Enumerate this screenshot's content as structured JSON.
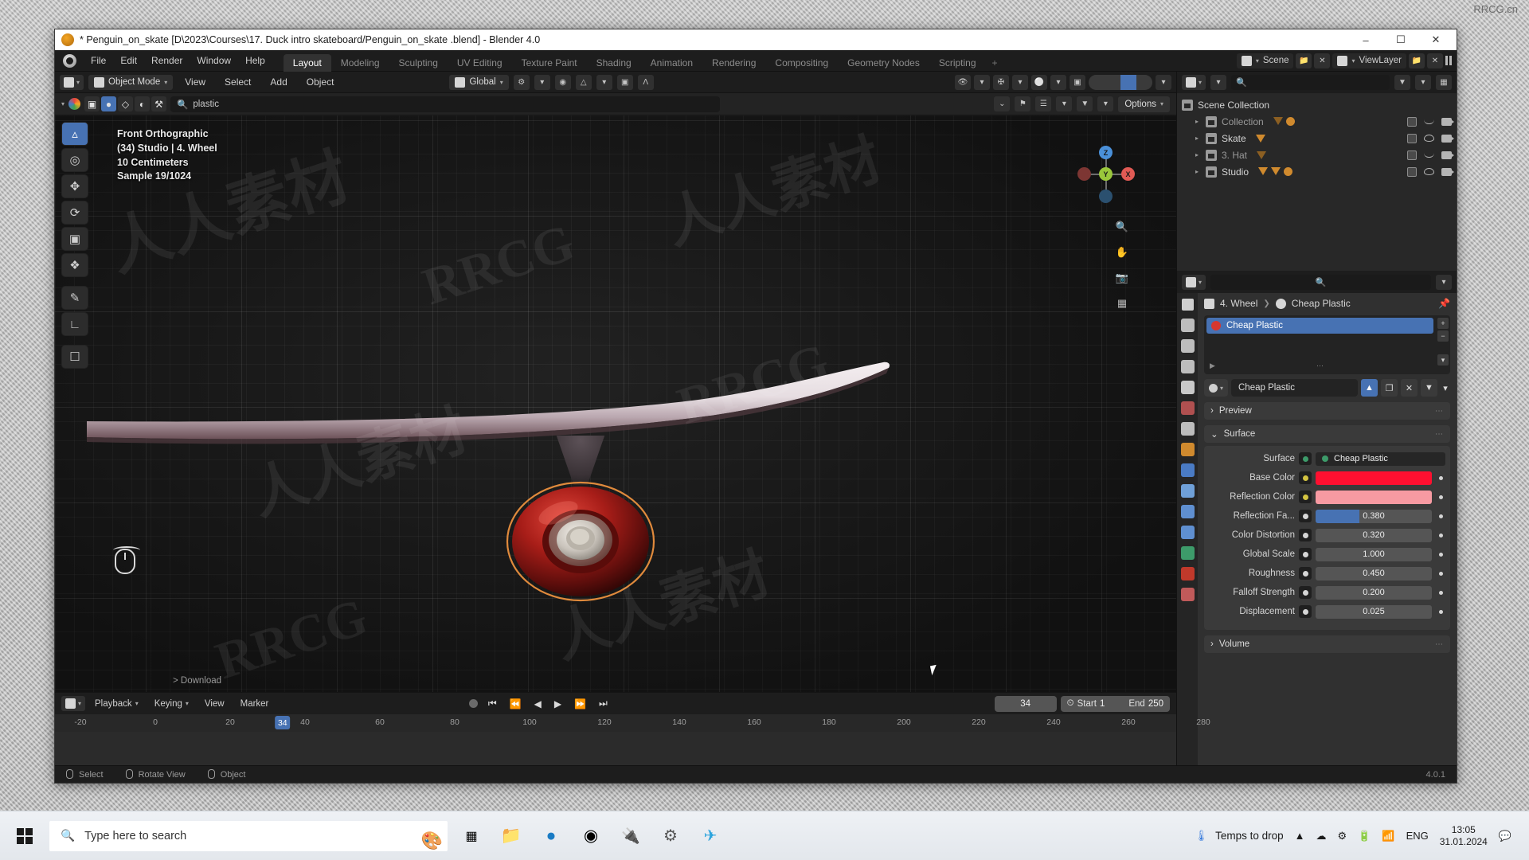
{
  "window": {
    "title": "* Penguin_on_skate  [D\\2023\\Courses\\17. Duck intro skateboard/Penguin_on_skate .blend] - Blender 4.0",
    "minimize": "–",
    "maximize": "☐",
    "close": "✕"
  },
  "menubar": {
    "items": [
      "File",
      "Edit",
      "Render",
      "Window",
      "Help"
    ],
    "workspaces": [
      {
        "label": "Layout",
        "active": true
      },
      {
        "label": "Modeling",
        "active": false
      },
      {
        "label": "Sculpting",
        "active": false
      },
      {
        "label": "UV Editing",
        "active": false
      },
      {
        "label": "Texture Paint",
        "active": false
      },
      {
        "label": "Shading",
        "active": false
      },
      {
        "label": "Animation",
        "active": false
      },
      {
        "label": "Rendering",
        "active": false
      },
      {
        "label": "Compositing",
        "active": false
      },
      {
        "label": "Geometry Nodes",
        "active": false
      },
      {
        "label": "Scripting",
        "active": false
      },
      {
        "label": "+",
        "active": false
      }
    ],
    "scene_label": "Scene",
    "viewlayer_label": "ViewLayer"
  },
  "viewport_header": {
    "mode": "Object Mode",
    "menus": [
      "View",
      "Select",
      "Add",
      "Object"
    ],
    "orientation": "Global",
    "options_label": "Options"
  },
  "viewport_search": {
    "value": "plastic",
    "placeholder": "Search"
  },
  "viewport_overlay": {
    "view_name": "Front Orthographic",
    "collection_object": "(34) Studio | 4. Wheel",
    "grid_scale": "10 Centimeters",
    "sample": "Sample 19/1024",
    "download_label": "> Download"
  },
  "gizmo": {
    "x": "X",
    "y": "Y",
    "z": "Z"
  },
  "tools": [
    {
      "name": "tweak-tool",
      "glyph": "◱",
      "active": true
    },
    {
      "name": "cursor-tool",
      "glyph": "◎",
      "active": false
    },
    {
      "name": "move-tool",
      "glyph": "✥",
      "active": false
    },
    {
      "name": "rotate-tool",
      "glyph": "↻",
      "active": false
    },
    {
      "name": "scale-tool",
      "glyph": "⧉",
      "active": false
    },
    {
      "name": "transform-tool",
      "glyph": "⬚",
      "active": false
    },
    {
      "name": "annotate-tool",
      "glyph": "✎",
      "active": false
    },
    {
      "name": "measure-tool",
      "glyph": "⊿",
      "active": false
    },
    {
      "name": "add-cube-tool",
      "glyph": "⬜",
      "active": false
    }
  ],
  "outliner": {
    "search_placeholder": "",
    "rows": [
      {
        "name": "Scene Collection",
        "indent": 0,
        "dim": false,
        "tags": [],
        "checkbox": false,
        "eye": null,
        "camera": false
      },
      {
        "name": "Collection",
        "indent": 1,
        "dim": true,
        "tags": [
          "tri-dark",
          "bulb"
        ],
        "checkbox": true,
        "eye": "closed",
        "camera": true
      },
      {
        "name": "Skate",
        "indent": 1,
        "dim": false,
        "tags": [
          "tri"
        ],
        "checkbox": true,
        "eye": "open",
        "camera": true
      },
      {
        "name": "3. Hat",
        "indent": 1,
        "dim": true,
        "tags": [
          "tri-dark"
        ],
        "checkbox": true,
        "eye": "closed",
        "camera": true
      },
      {
        "name": "Studio",
        "indent": 1,
        "dim": false,
        "tags": [
          "tri",
          "tri",
          "bulb"
        ],
        "checkbox": true,
        "eye": "open",
        "camera": true
      }
    ]
  },
  "properties": {
    "breadcrumb": [
      "4. Wheel",
      "Cheap Plastic"
    ],
    "material_slots": [
      {
        "name": "Cheap Plastic",
        "selected": true
      }
    ],
    "material_name": "Cheap Plastic",
    "panels": [
      {
        "label": "Preview",
        "open": false
      },
      {
        "label": "Surface",
        "open": true
      },
      {
        "label": "Volume",
        "open": false
      }
    ],
    "surface": {
      "rows": [
        {
          "label": "Surface",
          "socket": "green",
          "type": "name",
          "value": "Cheap Plastic"
        },
        {
          "label": "Base Color",
          "socket": "yellow",
          "type": "color",
          "value": "#ff1030"
        },
        {
          "label": "Reflection Color",
          "socket": "yellow",
          "type": "color",
          "value": "#f79aa2"
        },
        {
          "label": "Reflection Fa...",
          "socket": "grey",
          "type": "slider",
          "value": "0.380",
          "fill": 38
        },
        {
          "label": "Color Distortion",
          "socket": "grey",
          "type": "slider",
          "value": "0.320",
          "fill": 0
        },
        {
          "label": "Global Scale",
          "socket": "grey",
          "type": "slider",
          "value": "1.000",
          "fill": 0
        },
        {
          "label": "Roughness",
          "socket": "grey",
          "type": "slider",
          "value": "0.450",
          "fill": 0
        },
        {
          "label": "Falloff Strength",
          "socket": "grey",
          "type": "slider",
          "value": "0.200",
          "fill": 0
        },
        {
          "label": "Displacement",
          "socket": "grey",
          "type": "slider",
          "value": "0.025",
          "fill": 0
        }
      ]
    }
  },
  "timeline": {
    "menus": [
      "Playback",
      "Keying",
      "View",
      "Marker"
    ],
    "transport": [
      "⏮",
      "⏪",
      "◀",
      "▶",
      "⏩",
      "⏭"
    ],
    "current_frame": "34",
    "start_label": "Start",
    "start_value": "1",
    "end_label": "End",
    "end_value": "250",
    "ticks": [
      "-20",
      "0",
      "20",
      "40",
      "60",
      "80",
      "100",
      "120",
      "140",
      "160",
      "180",
      "200",
      "220",
      "240",
      "260",
      "280"
    ],
    "playhead_label": "34"
  },
  "statusbar": {
    "items": [
      "Select",
      "Rotate View",
      "Object"
    ],
    "version": "4.0.1"
  },
  "taskbar": {
    "search_placeholder": "Type here to search",
    "weather": "Temps to drop",
    "language": "ENG",
    "time": "13:05",
    "date": "31.01.2024"
  },
  "branding": {
    "logo_initials": "RR",
    "brand": "RRCG",
    "brand_sub": "人人素材",
    "corner": "RRCG.cn",
    "watermarks": [
      "RRCG",
      "人人素材"
    ]
  }
}
